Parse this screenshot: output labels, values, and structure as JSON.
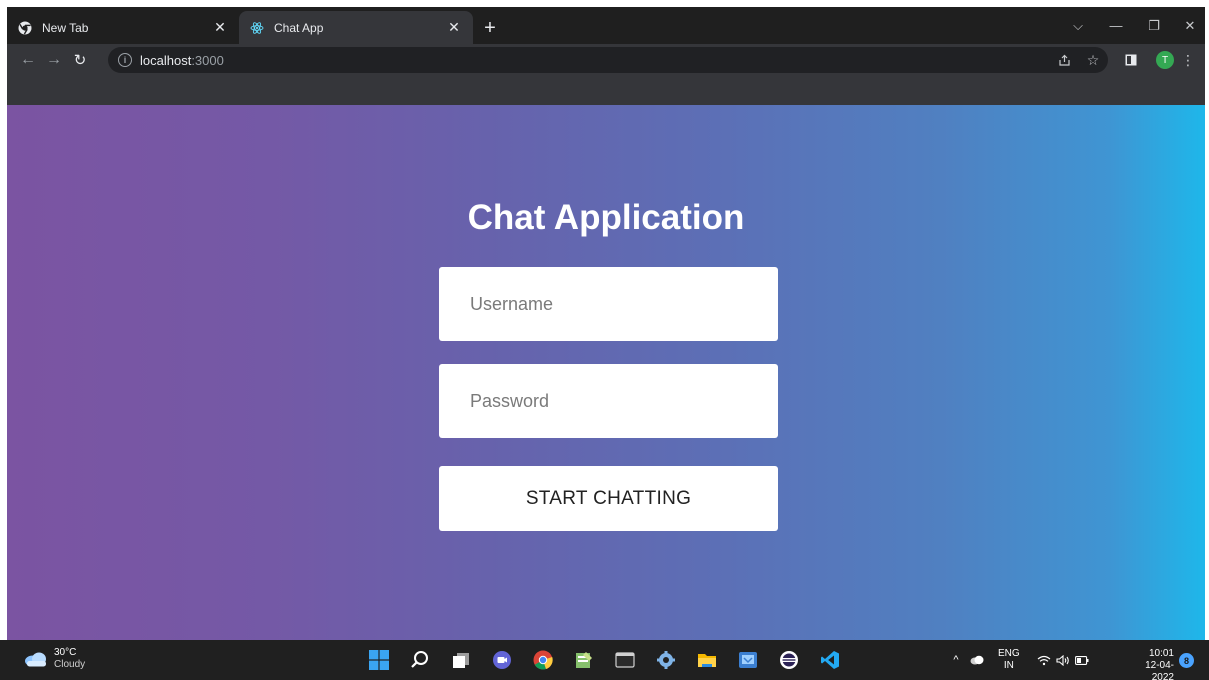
{
  "browser": {
    "tabs": [
      {
        "label": "New Tab",
        "icon": "chrome-icon",
        "active": false
      },
      {
        "label": "Chat App",
        "icon": "react-icon",
        "active": true
      }
    ],
    "address": {
      "host": "localhost",
      "port": ":3000"
    }
  },
  "page": {
    "title": "Chat Application",
    "username_placeholder": "Username",
    "password_placeholder": "Password",
    "start_button": "START CHATTING",
    "gradient": {
      "start": "#7b54a2",
      "end": "#1eb7ea"
    }
  },
  "taskbar": {
    "weather": {
      "temp": "30°C",
      "condition": "Cloudy"
    },
    "language": {
      "line1": "ENG",
      "line2": "IN"
    },
    "time": "10:01",
    "date": "12-04-2022",
    "notification_count": "8",
    "apps": [
      "windows-start-icon",
      "search-icon",
      "task-view-icon",
      "teams-chat-icon",
      "chrome-icon",
      "notepad-plus-icon",
      "terminal-icon",
      "settings-icon",
      "file-explorer-icon",
      "remote-desktop-icon",
      "eclipse-icon",
      "vscode-icon"
    ]
  },
  "profile": {
    "initial": "T"
  }
}
